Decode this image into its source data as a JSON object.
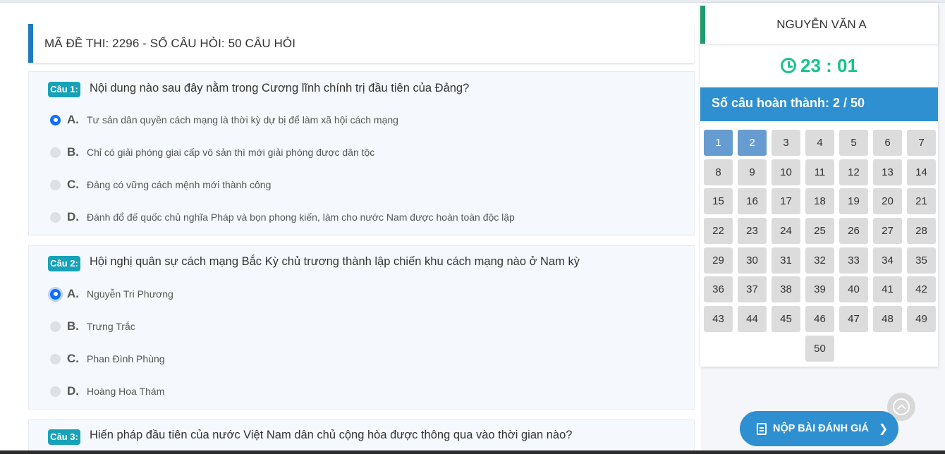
{
  "exam": {
    "title": "MÃ ĐỀ THI: 2296 - SỐ CÂU HỎI: 50 CÂU HỎI"
  },
  "questions": [
    {
      "badge": "Câu 1:",
      "text": "Nội dung nào sau đây nằm trong Cương lĩnh chính trị đầu tiên của Đảng?",
      "options": [
        {
          "letter": "A.",
          "text": "Tư sản dân quyền cách mạng là thời kỳ dự bị để làm xã hội cách mạng",
          "selected": true
        },
        {
          "letter": "B.",
          "text": "Chỉ có giải phóng giai cấp vô sản thì mới giải phóng được dân tộc",
          "selected": false
        },
        {
          "letter": "C.",
          "text": "Đảng có vững cách mệnh mới thành công",
          "selected": false
        },
        {
          "letter": "D.",
          "text": "Đánh đổ đế quốc chủ nghĩa Pháp và bọn phong kiến, làm cho nước Nam được hoàn toàn độc lập",
          "selected": false
        }
      ]
    },
    {
      "badge": "Câu 2:",
      "text": "Hội nghị quân sự cách mạng Bắc Kỳ chủ trương thành lập chiến khu cách mạng nào ở Nam kỳ",
      "options": [
        {
          "letter": "A.",
          "text": "Nguyễn Tri Phương",
          "selected": true
        },
        {
          "letter": "B.",
          "text": "Trưng Trắc",
          "selected": false
        },
        {
          "letter": "C.",
          "text": "Phan Đình Phùng",
          "selected": false
        },
        {
          "letter": "D.",
          "text": "Hoàng Hoa Thám",
          "selected": false
        }
      ]
    },
    {
      "badge": "Câu 3:",
      "text": "Hiến pháp đầu tiên của nước Việt Nam dân chủ cộng hòa được thông qua vào thời gian nào?"
    }
  ],
  "sidebar": {
    "student_name": "NGUYỄN VĂN A",
    "timer": "23 : 01",
    "progress_label": "Số câu hoàn thành: 2 / 50",
    "completed": [
      1,
      2
    ],
    "total": 50
  },
  "submit_label": "NỘP BÀI ĐÁNH GIÁ",
  "colors": {
    "accent": "#2e90d0",
    "timer": "#17c48b",
    "badge": "#17a2b8",
    "done_cell": "#679cd0"
  }
}
